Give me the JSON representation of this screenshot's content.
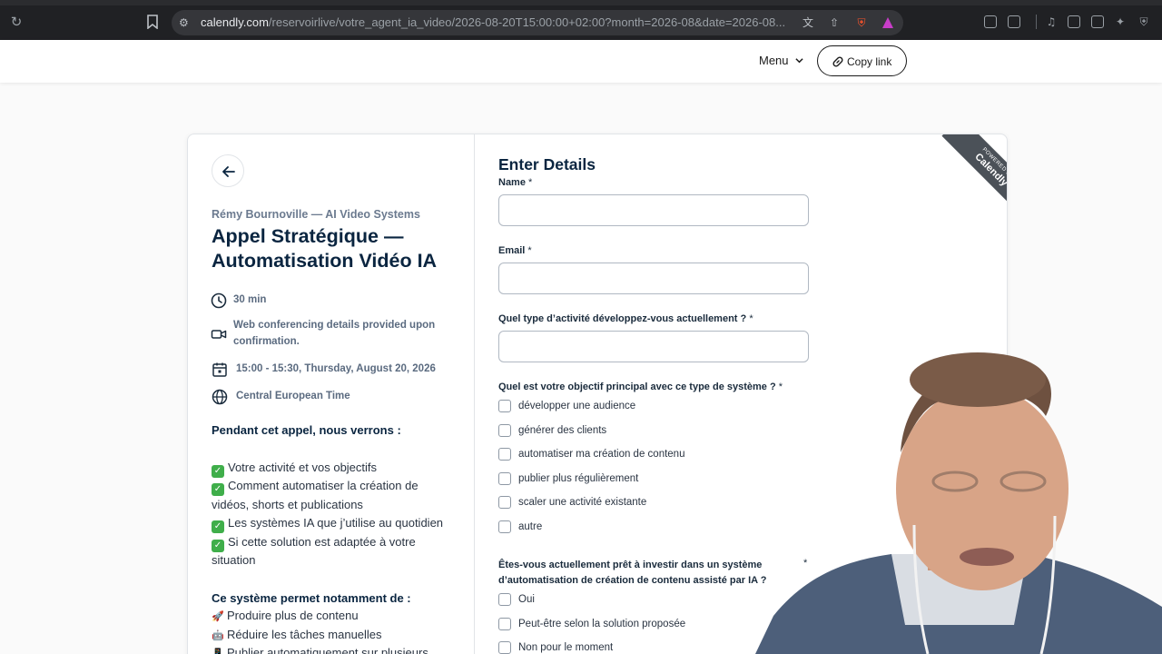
{
  "browser": {
    "url_host": "calendly.com",
    "url_path": "/reservoirlive/votre_agent_ia_video/2026-08-20T15:00:00+02:00?month=2026-08&date=2026-08...",
    "icons": [
      "reload-icon",
      "bookmark-icon",
      "site-settings-icon",
      "translate-icon",
      "share-icon",
      "brave-shields-icon",
      "brave-rewards-icon",
      "extensions-icon",
      "tab-search-icon",
      "media-icon",
      "sidebar-icon",
      "wallet-icon",
      "leo-icon",
      "vpn-icon"
    ]
  },
  "header": {
    "menu_label": "Menu",
    "copy_link_label": "Copy link"
  },
  "event": {
    "host": "Rémy Bournoville — AI Video Systems",
    "title_line1": "Appel Stratégique —",
    "title_line2": "Automatisation Vidéo IA",
    "duration": "30 min",
    "conferencing_line1": "Web conferencing details provided upon",
    "conferencing_line2": "confirmation.",
    "datetime": "15:00 - 15:30, Thursday, August 20, 2026",
    "timezone": "Central European Time"
  },
  "description": {
    "heading1": "Pendant cet appel, nous verrons :",
    "lines": [
      "Votre activité et vos objectifs",
      "Comment automatiser la création de",
      "vidéos, shorts et publications",
      "Les systèmes IA que j’utilise au quotidien",
      "Si cette solution est adaptée à votre",
      "situation"
    ],
    "heading2": "Ce système permet notamment de :",
    "benefits": [
      "Produire plus de contenu",
      "Réduire les tâches manuelles",
      "Publier automatiquement sur plusieurs"
    ],
    "benefit_icons": [
      "🚀",
      "🤖",
      "📱"
    ]
  },
  "form": {
    "title": "Enter Details",
    "name_label": "Name",
    "email_label": "Email",
    "activity_label": "Quel type d’activité développez-vous actuellement ?",
    "objective_label": "Quel est votre objectif principal avec ce type de système ?",
    "objective_options": [
      "développer une audience",
      "générer des clients",
      "automatiser ma création de contenu",
      "publier plus régulièrement",
      "scaler une activité existante",
      "autre"
    ],
    "invest_label_line1": "Êtes-vous actuellement prêt à investir dans un système",
    "invest_label_line2": "d’automatisation de création de contenu assisté par IA ?",
    "invest_options": [
      "Oui",
      "Peut-être selon la solution proposée",
      "Non pour le moment"
    ],
    "required_mark": "*"
  },
  "ribbon": {
    "line1": "POWERED BY",
    "line2": "Calendly"
  },
  "colors": {
    "primary_text": "#0a2540",
    "muted_text": "#5b6b80",
    "check_green": "#3fae4a",
    "ribbon": "#4b5158",
    "browser_bg": "#202124"
  }
}
